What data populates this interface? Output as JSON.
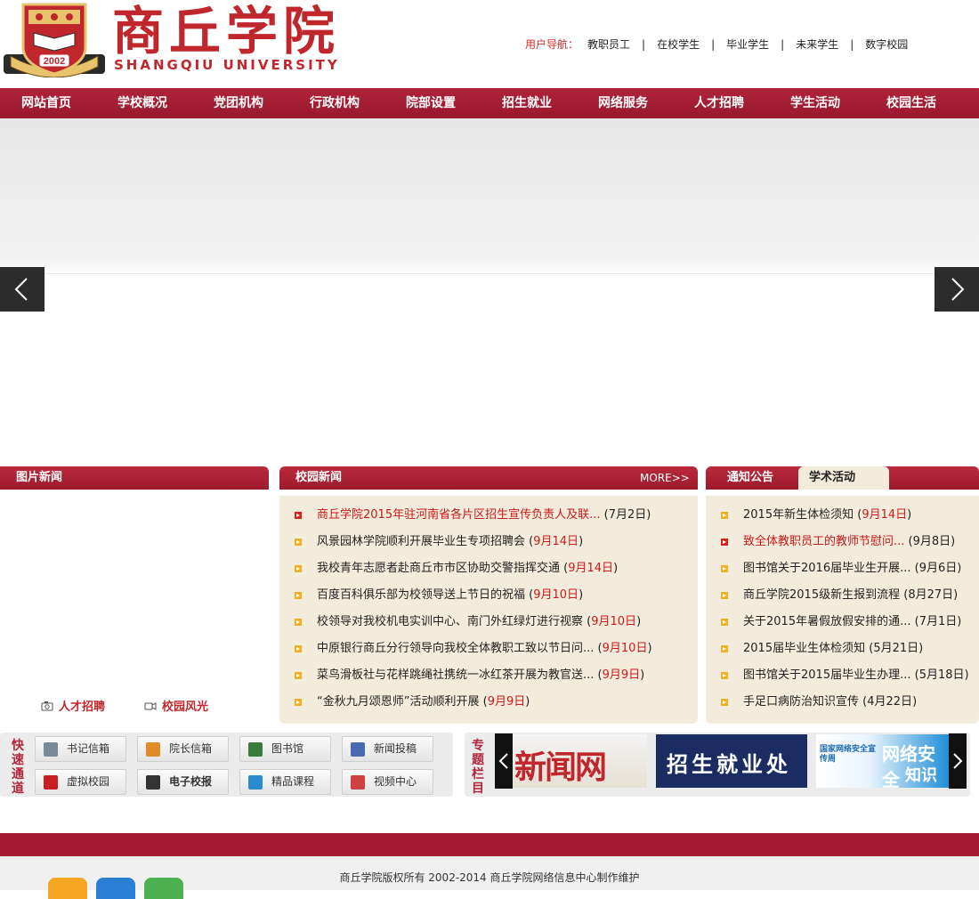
{
  "logo": {
    "cn": "商丘学院",
    "en": "SHANGQIU UNIVERSITY",
    "year": "2002"
  },
  "user_nav": {
    "label": "用户导航：",
    "items": [
      "教职员工",
      "在校学生",
      "毕业学生",
      "未来学生",
      "数字校园"
    ],
    "separator": "|"
  },
  "main_nav": [
    "网站首页",
    "学校概况",
    "党团机构",
    "行政机构",
    "院部设置",
    "招生就业",
    "网络服务",
    "人才招聘",
    "学生活动",
    "校园生活"
  ],
  "picture_news": {
    "title": "图片新闻",
    "tabs": [
      "人才招聘",
      "校园风光"
    ]
  },
  "campus_news": {
    "title": "校园新闻",
    "more": "MORE>>",
    "items": [
      {
        "title": "商丘学院2015年驻河南省各片区招生宣传负责人及联...",
        "date": "7月2日",
        "hot": true
      },
      {
        "title": "风景园林学院顺利开展毕业生专项招聘会",
        "date": "9月14日",
        "hot": false
      },
      {
        "title": "我校青年志愿者赴商丘市市区协助交警指挥交通",
        "date": "9月14日",
        "hot": false
      },
      {
        "title": "百度百科俱乐部为校领导送上节日的祝福",
        "date": "9月10日",
        "hot": false
      },
      {
        "title": "校领导对我校机电实训中心、南门外红绿灯进行视察",
        "date": "9月10日",
        "hot": false
      },
      {
        "title": "中原银行商丘分行领导向我校全体教职工致以节日问...",
        "date": "9月10日",
        "hot": false
      },
      {
        "title": "菜鸟滑板社与花样跳绳社携统一冰红茶开展为教官送...",
        "date": "9月9日",
        "hot": false
      },
      {
        "title": "“金秋九月颂恩师”活动顺利开展",
        "date": "9月9日",
        "hot": false
      }
    ]
  },
  "notices": {
    "tabs": [
      "通知公告",
      "学术活动"
    ],
    "items": [
      {
        "title": "2015年新生体检须知",
        "date": "9月14日",
        "hot": false,
        "red_date": true
      },
      {
        "title": "致全体教职员工的教师节慰问...",
        "date": "9月8日",
        "hot": true,
        "red_date": false
      },
      {
        "title": "图书馆关于2016届毕业生开展...",
        "date": "9月6日",
        "hot": false,
        "red_date": false
      },
      {
        "title": "商丘学院2015级新生报到流程",
        "date": "8月27日",
        "hot": false,
        "red_date": false
      },
      {
        "title": "关于2015年暑假放假安排的通...",
        "date": "7月1日",
        "hot": false,
        "red_date": false
      },
      {
        "title": "2015届毕业生体检须知",
        "date": "5月21日",
        "hot": false,
        "red_date": false
      },
      {
        "title": "图书馆关于2015届毕业生办理...",
        "date": "5月18日",
        "hot": false,
        "red_date": false
      },
      {
        "title": "手足口病防治知识宣传",
        "date": "4月22日",
        "hot": false,
        "red_date": false
      }
    ]
  },
  "quick_channel": {
    "label": "快速通道",
    "buttons": [
      {
        "label": "书记信箱",
        "icon": "mail-icon"
      },
      {
        "label": "院长信箱",
        "icon": "envelope-icon"
      },
      {
        "label": "图书馆",
        "icon": "notepad-icon"
      },
      {
        "label": "新闻投稿",
        "icon": "monitor-icon"
      },
      {
        "label": "虚拟校园",
        "icon": "virtual-campus-icon"
      },
      {
        "label": "电子校报",
        "icon": "newspaper-icon"
      },
      {
        "label": "精品课程",
        "icon": "books-icon"
      },
      {
        "label": "视频中心",
        "icon": "pie-icon"
      }
    ]
  },
  "special_column": {
    "label": "专题栏目",
    "banners": [
      "新闻网",
      "招生就业处",
      "网络安全",
      "知识手",
      "国家网络安全宣传周"
    ]
  },
  "footer": {
    "copyright": "商丘学院版权所有 2002-2014 商丘学院网络信息中心制作维护"
  },
  "colors": {
    "brand": "#a31c2f",
    "accent_red": "#d01818",
    "news_bg": "#f3ecdc"
  }
}
